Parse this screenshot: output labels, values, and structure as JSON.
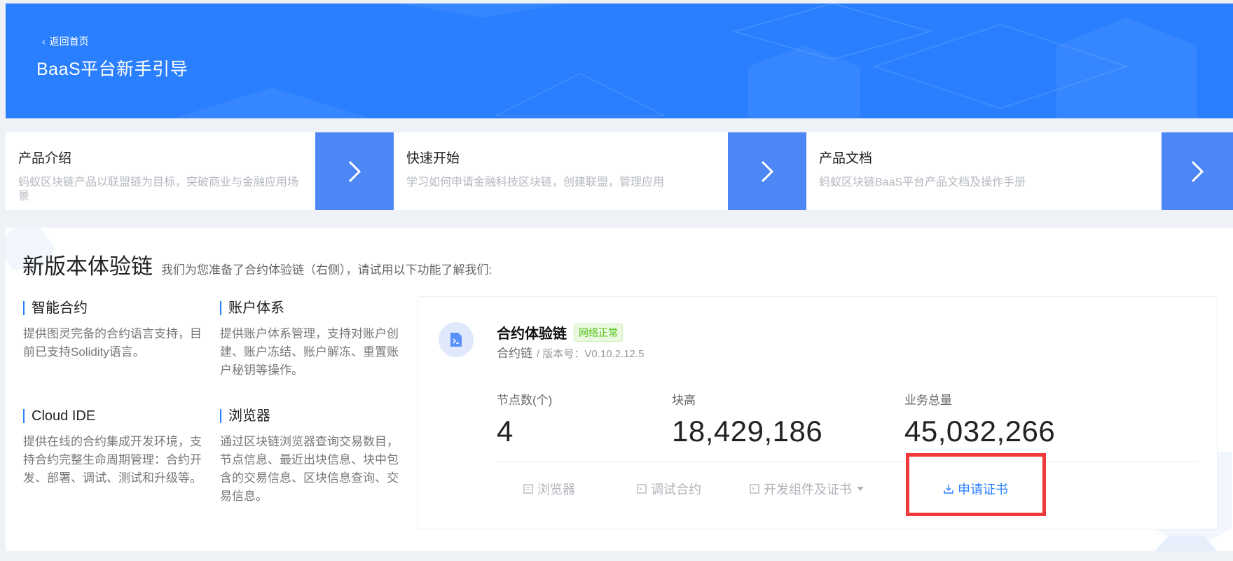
{
  "header": {
    "back_label": "返回首页",
    "title": "BaaS平台新手引导"
  },
  "nav_cards": [
    {
      "title": "产品介绍",
      "desc": "蚂蚁区块链产品以联盟链为目标，突破商业与金融应用场景"
    },
    {
      "title": "快速开始",
      "desc": "学习如何申请金融科技区块链，创建联盟，管理应用"
    },
    {
      "title": "产品文档",
      "desc": "蚂蚁区块链BaaS平台产品文档及操作手册"
    }
  ],
  "panel": {
    "title": "新版本体验链",
    "subtitle": "我们为您准备了合约体验链（右侧），请试用以下功能了解我们:"
  },
  "features": [
    {
      "title": "智能合约",
      "desc": "提供图灵完备的合约语言支持，目前已支持Solidity语言。"
    },
    {
      "title": "账户体系",
      "desc": "提供账户体系管理，支持对账户创建、账户冻结、账户解冻、重置账户秘钥等操作。"
    },
    {
      "title": "Cloud IDE",
      "desc": "提供在线的合约集成开发环境，支持合约完整生命周期管理：合约开发、部署、调试、测试和升级等。"
    },
    {
      "title": "浏览器",
      "desc": "通过区块链浏览器查询交易数目，节点信息、最近出块信息、块中包含的交易信息、区块信息查询、交易信息。"
    }
  ],
  "chain": {
    "name": "合约体验链",
    "status": "网络正常",
    "type": "合约链",
    "version_label": "/ 版本号：V0.10.2.12.5",
    "stats": [
      {
        "label": "节点数(个)",
        "value": "4"
      },
      {
        "label": "块高",
        "value": "18,429,186"
      },
      {
        "label": "业务总量",
        "value": "45,032,266"
      }
    ],
    "actions": [
      {
        "label": "浏览器",
        "icon": "browser-icon"
      },
      {
        "label": "调试合约",
        "icon": "terminal-icon"
      },
      {
        "label": "开发组件及证书",
        "icon": "terminal-icon"
      },
      {
        "label": "申请证书",
        "icon": "download-icon"
      }
    ]
  },
  "colors": {
    "brand": "#2a7fff",
    "arrow_bg": "#4d86f5",
    "status_green": "#52c41a",
    "highlight": "#f03a3a"
  }
}
